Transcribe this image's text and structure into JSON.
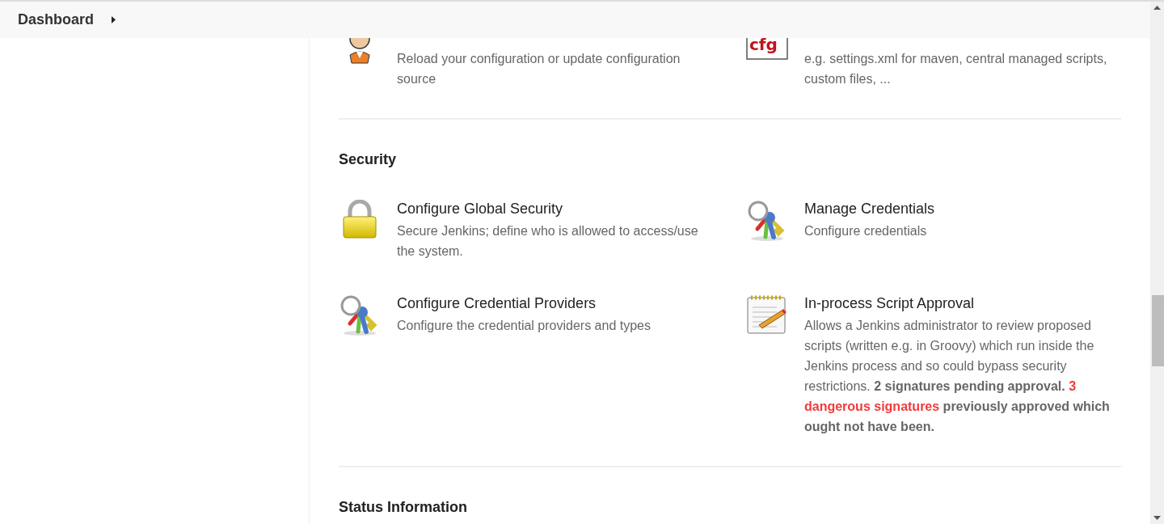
{
  "breadcrumb": [
    {
      "label": "Dashboard"
    }
  ],
  "sections": [
    {
      "items": [
        {
          "kind": "person",
          "description": "Reload your configuration or update configuration source"
        },
        {
          "kind": "file",
          "icon_label": "cfg",
          "description": "e.g. settings.xml for maven, central managed scripts, custom files, ..."
        }
      ]
    },
    {
      "title": "Security",
      "items": [
        {
          "kind": "padlock",
          "title": "Configure Global Security",
          "description": "Secure Jenkins; define who is allowed to access/use the system."
        },
        {
          "kind": "keys",
          "title": "Manage Credentials",
          "description": "Configure credentials"
        },
        {
          "kind": "keys",
          "title": "Configure Credential Providers",
          "description": "Configure the credential providers and types"
        },
        {
          "kind": "notepad",
          "title": "In-process Script Approval",
          "description_parts": [
            {
              "kind": "plain",
              "text": "Allows a Jenkins administrator to review proposed scripts (written e.g. in Groovy) which run inside the Jenkins process and so could bypass security restrictions."
            },
            {
              "kind": "bold",
              "text": "2 signatures pending approval."
            },
            {
              "kind": "warning",
              "text": "3 dangerous signatures"
            },
            {
              "kind": "bold",
              "text": "previously approved which ought not have been."
            }
          ]
        }
      ]
    },
    {
      "title": "Status Information"
    }
  ]
}
